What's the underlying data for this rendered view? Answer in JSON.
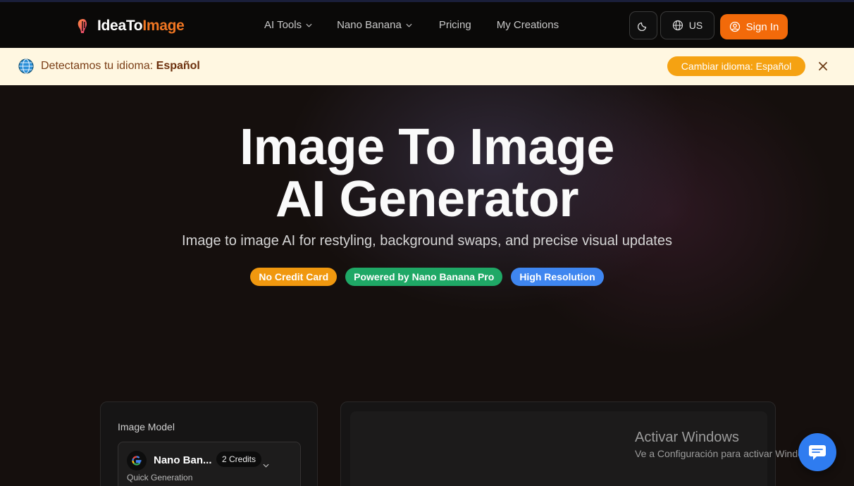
{
  "nav": {
    "logo": {
      "part1": "IdeaTo",
      "part2": "Image"
    },
    "menu": [
      {
        "label": "AI Tools",
        "has_dropdown": true
      },
      {
        "label": "Nano Banana",
        "has_dropdown": true
      },
      {
        "label": "Pricing",
        "has_dropdown": false
      },
      {
        "label": "My Creations",
        "has_dropdown": false
      }
    ],
    "theme_icon": "moon-icon",
    "language": {
      "icon": "globe-icon",
      "label": "US"
    },
    "sign_in": {
      "icon": "user-circle-icon",
      "label": "Sign In"
    }
  },
  "banner": {
    "icon": "globe-icon",
    "text": "Detectamos tu idioma:",
    "language": "Español",
    "cta": "Cambiar idioma: Español",
    "close_icon": "close-icon"
  },
  "hero": {
    "title_line1": "Image To Image",
    "title_line2": "AI Generator",
    "subtitle": "Image to image AI for restyling, background swaps, and precise visual updates",
    "badges": [
      {
        "label": "No Credit Card",
        "color": "#f0980f"
      },
      {
        "label": "Powered by Nano Banana Pro",
        "color": "#1fa866"
      },
      {
        "label": "High Resolution",
        "color": "#3f86f0"
      }
    ]
  },
  "generator": {
    "model_label": "Image Model",
    "model": {
      "icon": "google-icon",
      "name": "Nano Ban...",
      "credits": "2 Credits",
      "mode": "Quick Generation"
    }
  },
  "watermark": {
    "title": "Activar Windows",
    "subtitle": "Ve a Configuración para activar Windows."
  },
  "chat": {
    "icon": "chat-icon"
  },
  "colors": {
    "accent": "#f26a0a",
    "logo_accent": "#f07622",
    "banner_bg": "#fff7e1",
    "banner_cta": "#f5a212",
    "background": "#150f0d"
  }
}
